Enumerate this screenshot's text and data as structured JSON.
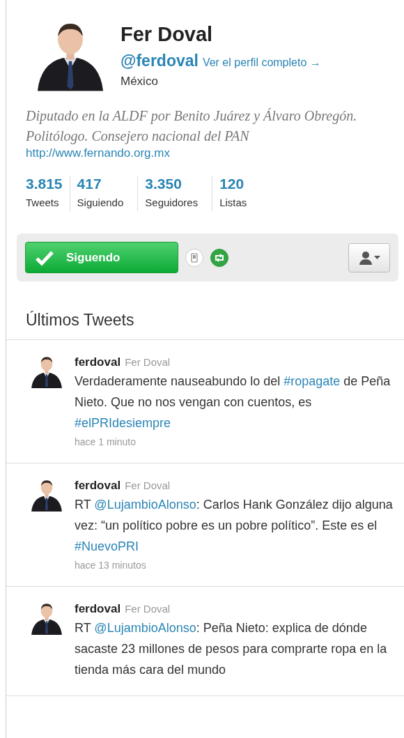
{
  "profile": {
    "name": "Fer Doval",
    "handle": "@ferdoval",
    "full_profile_link": "Ver el perfil completo →",
    "location": "México",
    "bio": "Diputado en la ALDF por Benito Juárez y Álvaro Obregón. Politólogo. Consejero nacional del PAN",
    "url": "http://www.fernando.org.mx"
  },
  "stats": [
    {
      "value": "3.815",
      "label": "Tweets"
    },
    {
      "value": "417",
      "label": "Siguiendo"
    },
    {
      "value": "3.350",
      "label": "Seguidores"
    },
    {
      "value": "120",
      "label": "Listas"
    }
  ],
  "actions": {
    "follow_button": "Siguendo",
    "following": true
  },
  "section_title": "Últimos Tweets",
  "tweets": [
    {
      "username": "ferdoval",
      "display_name": "Fer Doval",
      "segments": [
        {
          "kind": "text",
          "text": "Verdaderamente nauseabundo lo del "
        },
        {
          "kind": "hashtag",
          "text": "#ropagate"
        },
        {
          "kind": "text",
          "text": " de Peña Nieto. Que no nos vengan con cuentos, es "
        },
        {
          "kind": "hashtag",
          "text": "#elPRIdesiempre"
        }
      ],
      "time": "hace 1 minuto"
    },
    {
      "username": "ferdoval",
      "display_name": "Fer Doval",
      "segments": [
        {
          "kind": "text",
          "text": "RT "
        },
        {
          "kind": "mention",
          "text": "@LujambioAlonso"
        },
        {
          "kind": "text",
          "text": ": Carlos Hank González dijo alguna vez: “un político pobre es un pobre político”. Este es el "
        },
        {
          "kind": "hashtag",
          "text": "#NuevoPRI"
        }
      ],
      "time": "hace 13 minutos"
    },
    {
      "username": "ferdoval",
      "display_name": "Fer Doval",
      "segments": [
        {
          "kind": "text",
          "text": "RT "
        },
        {
          "kind": "mention",
          "text": "@LujambioAlonso"
        },
        {
          "kind": "text",
          "text": ": Peña Nieto: explica de dónde sacaste 23 millones de pesos para comprarte ropa en la tienda más cara del mundo"
        }
      ]
    }
  ]
}
